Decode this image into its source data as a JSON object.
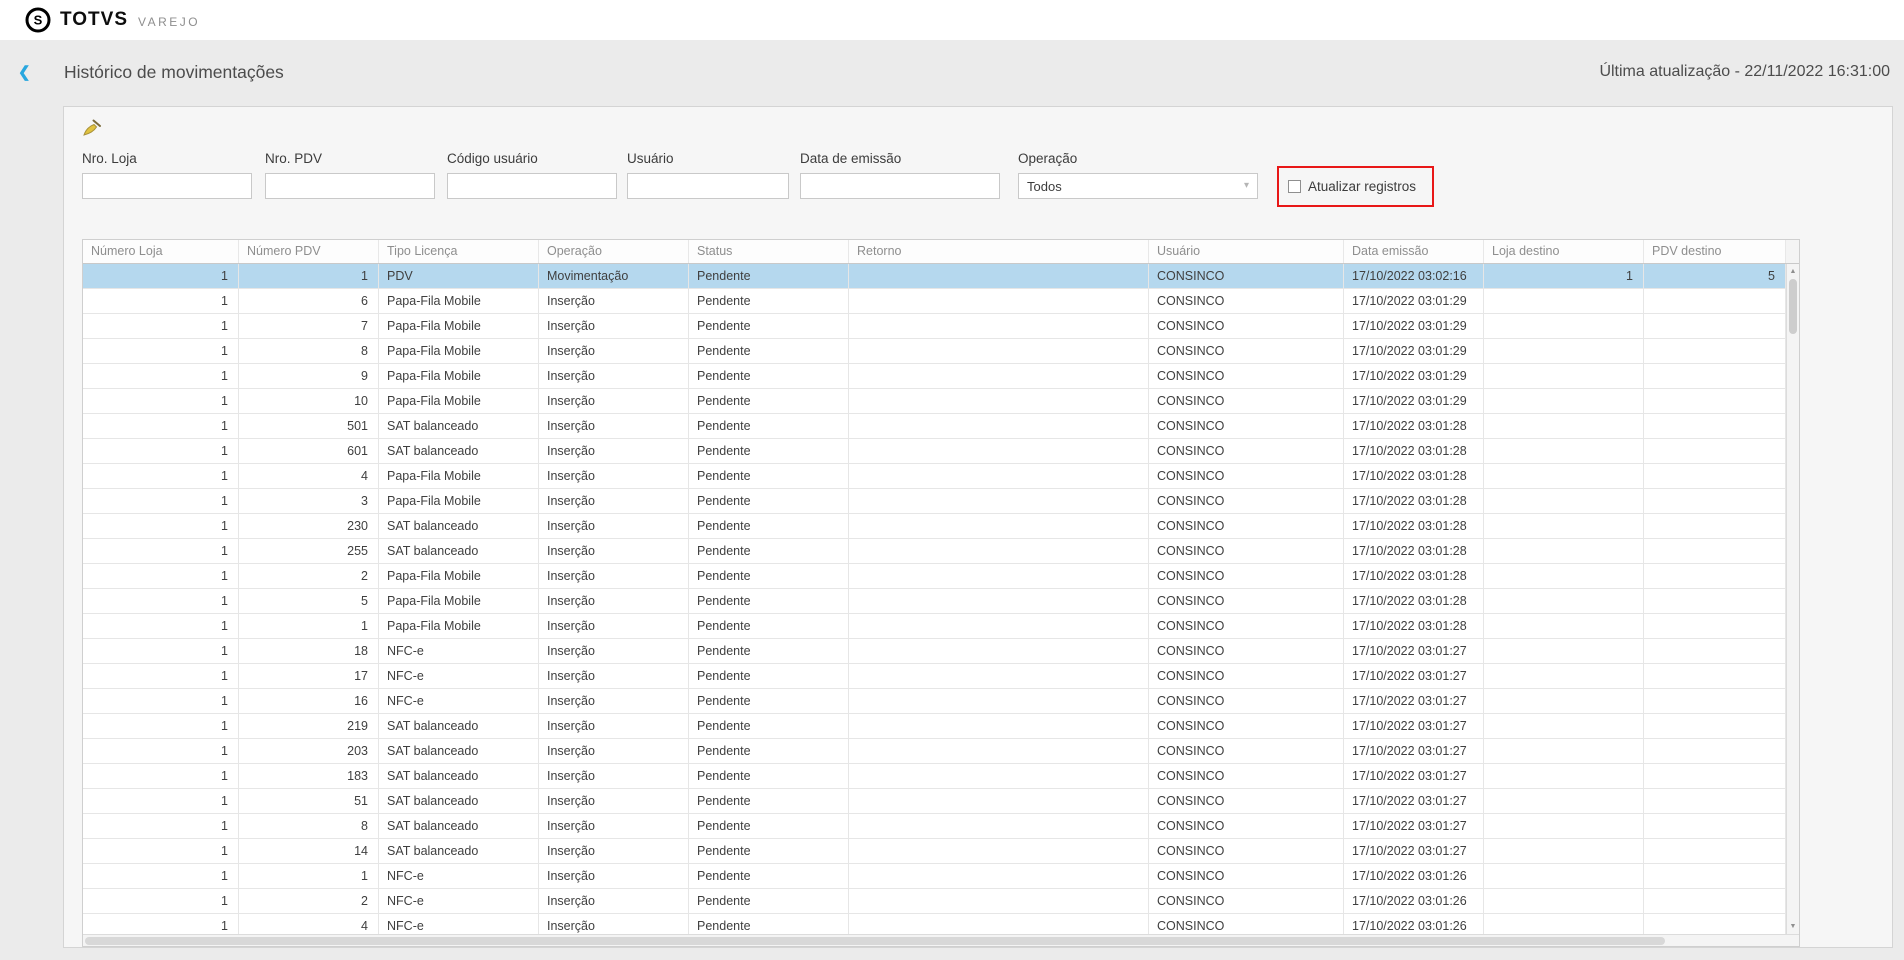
{
  "topbar": {
    "brand": "TOTVS",
    "segment": "VAREJO"
  },
  "header": {
    "title": "Histórico de movimentações",
    "last_update": "Última atualização - 22/11/2022 16:31:00"
  },
  "icons": {
    "back": "❮",
    "caret_down": "▾",
    "scroll_up": "▲",
    "scroll_down": "▼",
    "clear_filters": "broom-icon"
  },
  "filters": {
    "nro_loja_label": "Nro. Loja",
    "nro_pdv_label": "Nro. PDV",
    "codigo_usuario_label": "Código usuário",
    "usuario_label": "Usuário",
    "data_emissao_label": "Data de emissão",
    "operacao_label": "Operação",
    "operacao_value": "Todos",
    "atualizar_registros_label": "Atualizar registros",
    "atualizar_registros_checked": false
  },
  "colors": {
    "selected_row": "#b5d8ee",
    "highlight_red": "#e81717",
    "accent_blue": "#28a7df"
  },
  "table": {
    "columns": [
      "Número Loja",
      "Número PDV",
      "Tipo Licença",
      "Operação",
      "Status",
      "Retorno",
      "Usuário",
      "Data emissão",
      "Loja destino",
      "PDV destino"
    ],
    "selected_row_index": 0,
    "rows": [
      [
        "1",
        "1",
        "PDV",
        "Movimentação",
        "Pendente",
        "",
        "CONSINCO",
        "17/10/2022 03:02:16",
        "1",
        "5"
      ],
      [
        "1",
        "6",
        "Papa-Fila Mobile",
        "Inserção",
        "Pendente",
        "",
        "CONSINCO",
        "17/10/2022 03:01:29",
        "",
        ""
      ],
      [
        "1",
        "7",
        "Papa-Fila Mobile",
        "Inserção",
        "Pendente",
        "",
        "CONSINCO",
        "17/10/2022 03:01:29",
        "",
        ""
      ],
      [
        "1",
        "8",
        "Papa-Fila Mobile",
        "Inserção",
        "Pendente",
        "",
        "CONSINCO",
        "17/10/2022 03:01:29",
        "",
        ""
      ],
      [
        "1",
        "9",
        "Papa-Fila Mobile",
        "Inserção",
        "Pendente",
        "",
        "CONSINCO",
        "17/10/2022 03:01:29",
        "",
        ""
      ],
      [
        "1",
        "10",
        "Papa-Fila Mobile",
        "Inserção",
        "Pendente",
        "",
        "CONSINCO",
        "17/10/2022 03:01:29",
        "",
        ""
      ],
      [
        "1",
        "501",
        "SAT balanceado",
        "Inserção",
        "Pendente",
        "",
        "CONSINCO",
        "17/10/2022 03:01:28",
        "",
        ""
      ],
      [
        "1",
        "601",
        "SAT balanceado",
        "Inserção",
        "Pendente",
        "",
        "CONSINCO",
        "17/10/2022 03:01:28",
        "",
        ""
      ],
      [
        "1",
        "4",
        "Papa-Fila Mobile",
        "Inserção",
        "Pendente",
        "",
        "CONSINCO",
        "17/10/2022 03:01:28",
        "",
        ""
      ],
      [
        "1",
        "3",
        "Papa-Fila Mobile",
        "Inserção",
        "Pendente",
        "",
        "CONSINCO",
        "17/10/2022 03:01:28",
        "",
        ""
      ],
      [
        "1",
        "230",
        "SAT balanceado",
        "Inserção",
        "Pendente",
        "",
        "CONSINCO",
        "17/10/2022 03:01:28",
        "",
        ""
      ],
      [
        "1",
        "255",
        "SAT balanceado",
        "Inserção",
        "Pendente",
        "",
        "CONSINCO",
        "17/10/2022 03:01:28",
        "",
        ""
      ],
      [
        "1",
        "2",
        "Papa-Fila Mobile",
        "Inserção",
        "Pendente",
        "",
        "CONSINCO",
        "17/10/2022 03:01:28",
        "",
        ""
      ],
      [
        "1",
        "5",
        "Papa-Fila Mobile",
        "Inserção",
        "Pendente",
        "",
        "CONSINCO",
        "17/10/2022 03:01:28",
        "",
        ""
      ],
      [
        "1",
        "1",
        "Papa-Fila Mobile",
        "Inserção",
        "Pendente",
        "",
        "CONSINCO",
        "17/10/2022 03:01:28",
        "",
        ""
      ],
      [
        "1",
        "18",
        "NFC-e",
        "Inserção",
        "Pendente",
        "",
        "CONSINCO",
        "17/10/2022 03:01:27",
        "",
        ""
      ],
      [
        "1",
        "17",
        "NFC-e",
        "Inserção",
        "Pendente",
        "",
        "CONSINCO",
        "17/10/2022 03:01:27",
        "",
        ""
      ],
      [
        "1",
        "16",
        "NFC-e",
        "Inserção",
        "Pendente",
        "",
        "CONSINCO",
        "17/10/2022 03:01:27",
        "",
        ""
      ],
      [
        "1",
        "219",
        "SAT balanceado",
        "Inserção",
        "Pendente",
        "",
        "CONSINCO",
        "17/10/2022 03:01:27",
        "",
        ""
      ],
      [
        "1",
        "203",
        "SAT balanceado",
        "Inserção",
        "Pendente",
        "",
        "CONSINCO",
        "17/10/2022 03:01:27",
        "",
        ""
      ],
      [
        "1",
        "183",
        "SAT balanceado",
        "Inserção",
        "Pendente",
        "",
        "CONSINCO",
        "17/10/2022 03:01:27",
        "",
        ""
      ],
      [
        "1",
        "51",
        "SAT balanceado",
        "Inserção",
        "Pendente",
        "",
        "CONSINCO",
        "17/10/2022 03:01:27",
        "",
        ""
      ],
      [
        "1",
        "8",
        "SAT balanceado",
        "Inserção",
        "Pendente",
        "",
        "CONSINCO",
        "17/10/2022 03:01:27",
        "",
        ""
      ],
      [
        "1",
        "14",
        "SAT balanceado",
        "Inserção",
        "Pendente",
        "",
        "CONSINCO",
        "17/10/2022 03:01:27",
        "",
        ""
      ],
      [
        "1",
        "1",
        "NFC-e",
        "Inserção",
        "Pendente",
        "",
        "CONSINCO",
        "17/10/2022 03:01:26",
        "",
        ""
      ],
      [
        "1",
        "2",
        "NFC-e",
        "Inserção",
        "Pendente",
        "",
        "CONSINCO",
        "17/10/2022 03:01:26",
        "",
        ""
      ],
      [
        "1",
        "4",
        "NFC-e",
        "Inserção",
        "Pendente",
        "",
        "CONSINCO",
        "17/10/2022 03:01:26",
        "",
        ""
      ]
    ]
  }
}
